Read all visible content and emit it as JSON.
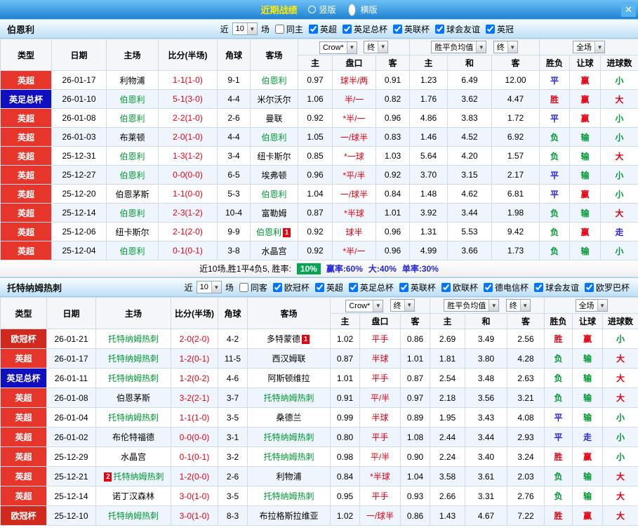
{
  "topbar": {
    "title": "近期战绩",
    "radios": [
      {
        "label": "竖版",
        "selected": false
      },
      {
        "label": "横版",
        "selected": true
      }
    ],
    "close_icon": "✕"
  },
  "colors": {
    "league": {
      "英超": "#e6352b",
      "英足总杯": "#0f0fc0",
      "欧冠杯": "#d2291f"
    },
    "focus_team": "#009933",
    "score": "#e60012",
    "win": "#e60012",
    "lose": "#009933",
    "draw": "#2626d8",
    "rate_badge_bg": "#00a651"
  },
  "table_header": {
    "type": "类型",
    "date": "日期",
    "home": "主场",
    "score": "比分(半场)",
    "corner": "角球",
    "away": "客场",
    "odds_select": "Crow*",
    "odds_end": "终",
    "odds_home": "主",
    "odds_handicap": "盘口",
    "odds_away": "客",
    "eu_select": "胜平负均值",
    "eu_end": "终",
    "eu_home": "主",
    "eu_draw": "和",
    "eu_away": "客",
    "full_select": "全场",
    "res_result": "胜负",
    "res_handicap": "让球",
    "res_goals": "进球数"
  },
  "sections": [
    {
      "team": "伯恩利",
      "filter": {
        "prefix": "近",
        "count": "10",
        "suffix": "场",
        "items": [
          {
            "label": "同主",
            "checked": false
          },
          {
            "label": "英超",
            "checked": true
          },
          {
            "label": "英足总杯",
            "checked": true
          },
          {
            "label": "英联杯",
            "checked": true
          },
          {
            "label": "球会友谊",
            "checked": true
          },
          {
            "label": "英冠",
            "checked": true
          }
        ]
      },
      "rows": [
        {
          "league": "英超",
          "date": "26-01-17",
          "home": "利物浦",
          "score": "1-1(1-0)",
          "corner": "9-1",
          "away": "伯恩利",
          "away_focus": true,
          "ah": [
            "0.97",
            "球半/两",
            "0.91"
          ],
          "eu": [
            "1.23",
            "6.49",
            "12.00"
          ],
          "res": [
            "平",
            "赢",
            "小"
          ]
        },
        {
          "league": "英足总杯",
          "date": "26-01-10",
          "home": "伯恩利",
          "home_focus": true,
          "score": "5-1(3-0)",
          "corner": "4-4",
          "away": "米尔沃尔",
          "ah": [
            "1.06",
            "半/一",
            "0.82"
          ],
          "eu": [
            "1.76",
            "3.62",
            "4.47"
          ],
          "res": [
            "胜",
            "赢",
            "大"
          ]
        },
        {
          "league": "英超",
          "date": "26-01-08",
          "home": "伯恩利",
          "home_focus": true,
          "score": "2-2(1-0)",
          "corner": "2-6",
          "away": "曼联",
          "ah": [
            "0.92",
            "*半/一",
            "0.96"
          ],
          "eu": [
            "4.86",
            "3.83",
            "1.72"
          ],
          "res": [
            "平",
            "赢",
            "小"
          ]
        },
        {
          "league": "英超",
          "date": "26-01-03",
          "home": "布莱顿",
          "score": "2-0(1-0)",
          "corner": "4-4",
          "away": "伯恩利",
          "away_focus": true,
          "ah": [
            "1.05",
            "一/球半",
            "0.83"
          ],
          "eu": [
            "1.46",
            "4.52",
            "6.92"
          ],
          "res": [
            "负",
            "输",
            "小"
          ]
        },
        {
          "league": "英超",
          "date": "25-12-31",
          "home": "伯恩利",
          "home_focus": true,
          "score": "1-3(1-2)",
          "corner": "3-4",
          "away": "纽卡斯尔",
          "ah": [
            "0.85",
            "*一球",
            "1.03"
          ],
          "eu": [
            "5.64",
            "4.20",
            "1.57"
          ],
          "res": [
            "负",
            "输",
            "大"
          ]
        },
        {
          "league": "英超",
          "date": "25-12-27",
          "home": "伯恩利",
          "home_focus": true,
          "score": "0-0(0-0)",
          "corner": "6-5",
          "away": "埃弗顿",
          "ah": [
            "0.96",
            "*平/半",
            "0.92"
          ],
          "eu": [
            "3.70",
            "3.15",
            "2.17"
          ],
          "res": [
            "平",
            "输",
            "小"
          ]
        },
        {
          "league": "英超",
          "date": "25-12-20",
          "home": "伯恩茅斯",
          "score": "1-1(0-0)",
          "corner": "5-3",
          "away": "伯恩利",
          "away_focus": true,
          "ah": [
            "1.04",
            "一/球半",
            "0.84"
          ],
          "eu": [
            "1.48",
            "4.62",
            "6.81"
          ],
          "res": [
            "平",
            "赢",
            "小"
          ]
        },
        {
          "league": "英超",
          "date": "25-12-14",
          "home": "伯恩利",
          "home_focus": true,
          "score": "2-3(1-2)",
          "corner": "10-4",
          "away": "富勒姆",
          "ah": [
            "0.87",
            "*半球",
            "1.01"
          ],
          "eu": [
            "3.92",
            "3.44",
            "1.98"
          ],
          "res": [
            "负",
            "输",
            "大"
          ]
        },
        {
          "league": "英超",
          "date": "25-12-06",
          "home": "纽卡斯尔",
          "score": "2-1(2-0)",
          "corner": "9-9",
          "away": "伯恩利",
          "away_focus": true,
          "away_badge": "1",
          "ah": [
            "0.92",
            "球半",
            "0.96"
          ],
          "eu": [
            "1.31",
            "5.53",
            "9.42"
          ],
          "res": [
            "负",
            "赢",
            "走"
          ]
        },
        {
          "league": "英超",
          "date": "25-12-04",
          "home": "伯恩利",
          "home_focus": true,
          "score": "0-1(0-1)",
          "corner": "3-8",
          "away": "水晶宫",
          "ah": [
            "0.92",
            "*半/一",
            "0.96"
          ],
          "eu": [
            "4.99",
            "3.66",
            "1.73"
          ],
          "res": [
            "负",
            "输",
            "小"
          ]
        }
      ],
      "footer": {
        "summary": "近10场,胜1平4负5, 胜率:",
        "rate_badge": "10%",
        "stats": [
          "赢率:60%",
          "大:40%",
          "单率:30%"
        ]
      }
    },
    {
      "team": "托特纳姆热刺",
      "filter": {
        "prefix": "近",
        "count": "10",
        "suffix": "场",
        "items": [
          {
            "label": "同客",
            "checked": false
          },
          {
            "label": "欧冠杯",
            "checked": true
          },
          {
            "label": "英超",
            "checked": true
          },
          {
            "label": "英足总杯",
            "checked": true
          },
          {
            "label": "英联杯",
            "checked": true
          },
          {
            "label": "欧联杯",
            "checked": true
          },
          {
            "label": "德电信杯",
            "checked": true
          },
          {
            "label": "球会友谊",
            "checked": true
          },
          {
            "label": "欧罗巴杯",
            "checked": true
          }
        ]
      },
      "rows": [
        {
          "league": "欧冠杯",
          "date": "26-01-21",
          "home": "托特纳姆热刺",
          "home_focus": true,
          "score": "2-0(2-0)",
          "corner": "4-2",
          "away": "多特蒙德",
          "away_badge": "1",
          "ah": [
            "1.02",
            "平手",
            "0.86"
          ],
          "eu": [
            "2.69",
            "3.49",
            "2.56"
          ],
          "res": [
            "胜",
            "赢",
            "小"
          ]
        },
        {
          "league": "英超",
          "date": "26-01-17",
          "home": "托特纳姆热刺",
          "home_focus": true,
          "score": "1-2(0-1)",
          "corner": "11-5",
          "away": "西汉姆联",
          "ah": [
            "0.87",
            "半球",
            "1.01"
          ],
          "eu": [
            "1.81",
            "3.80",
            "4.28"
          ],
          "res": [
            "负",
            "输",
            "大"
          ]
        },
        {
          "league": "英足总杯",
          "date": "26-01-11",
          "home": "托特纳姆热刺",
          "home_focus": true,
          "score": "1-2(0-2)",
          "corner": "4-6",
          "away": "阿斯顿维拉",
          "ah": [
            "1.01",
            "平手",
            "0.87"
          ],
          "eu": [
            "2.54",
            "3.48",
            "2.63"
          ],
          "res": [
            "负",
            "输",
            "大"
          ]
        },
        {
          "league": "英超",
          "date": "26-01-08",
          "home": "伯恩茅斯",
          "score": "3-2(2-1)",
          "corner": "3-7",
          "away": "托特纳姆热刺",
          "away_focus": true,
          "ah": [
            "0.91",
            "平/半",
            "0.97"
          ],
          "eu": [
            "2.18",
            "3.56",
            "3.21"
          ],
          "res": [
            "负",
            "输",
            "大"
          ]
        },
        {
          "league": "英超",
          "date": "26-01-04",
          "home": "托特纳姆热刺",
          "home_focus": true,
          "score": "1-1(1-0)",
          "corner": "3-5",
          "away": "桑德兰",
          "ah": [
            "0.99",
            "半球",
            "0.89"
          ],
          "eu": [
            "1.95",
            "3.43",
            "4.08"
          ],
          "res": [
            "平",
            "输",
            "小"
          ]
        },
        {
          "league": "英超",
          "date": "26-01-02",
          "home": "布伦特福德",
          "score": "0-0(0-0)",
          "corner": "3-1",
          "away": "托特纳姆热刺",
          "away_focus": true,
          "ah": [
            "0.80",
            "平手",
            "1.08"
          ],
          "eu": [
            "2.44",
            "3.44",
            "2.93"
          ],
          "res": [
            "平",
            "走",
            "小"
          ]
        },
        {
          "league": "英超",
          "date": "25-12-29",
          "home": "水晶宫",
          "score": "0-1(0-1)",
          "corner": "3-2",
          "away": "托特纳姆热刺",
          "away_focus": true,
          "ah": [
            "0.98",
            "平/半",
            "0.90"
          ],
          "eu": [
            "2.24",
            "3.40",
            "3.24"
          ],
          "res": [
            "胜",
            "赢",
            "小"
          ]
        },
        {
          "league": "英超",
          "date": "25-12-21",
          "home": "托特纳姆热刺",
          "home_focus": true,
          "home_badge": "2",
          "score": "1-2(0-0)",
          "corner": "2-6",
          "away": "利物浦",
          "ah": [
            "0.84",
            "*半球",
            "1.04"
          ],
          "eu": [
            "3.58",
            "3.61",
            "2.03"
          ],
          "res": [
            "负",
            "输",
            "大"
          ]
        },
        {
          "league": "英超",
          "date": "25-12-14",
          "home": "诺丁汉森林",
          "score": "3-0(1-0)",
          "corner": "3-5",
          "away": "托特纳姆热刺",
          "away_focus": true,
          "ah": [
            "0.95",
            "平手",
            "0.93"
          ],
          "eu": [
            "2.66",
            "3.31",
            "2.76"
          ],
          "res": [
            "负",
            "输",
            "大"
          ]
        },
        {
          "league": "欧冠杯",
          "date": "25-12-10",
          "home": "托特纳姆热刺",
          "home_focus": true,
          "score": "3-0(1-0)",
          "corner": "8-3",
          "away": "布拉格斯拉维亚",
          "ah": [
            "1.02",
            "一/球半",
            "0.86"
          ],
          "eu": [
            "1.43",
            "4.67",
            "7.22"
          ],
          "res": [
            "胜",
            "赢",
            "大"
          ]
        }
      ]
    }
  ]
}
